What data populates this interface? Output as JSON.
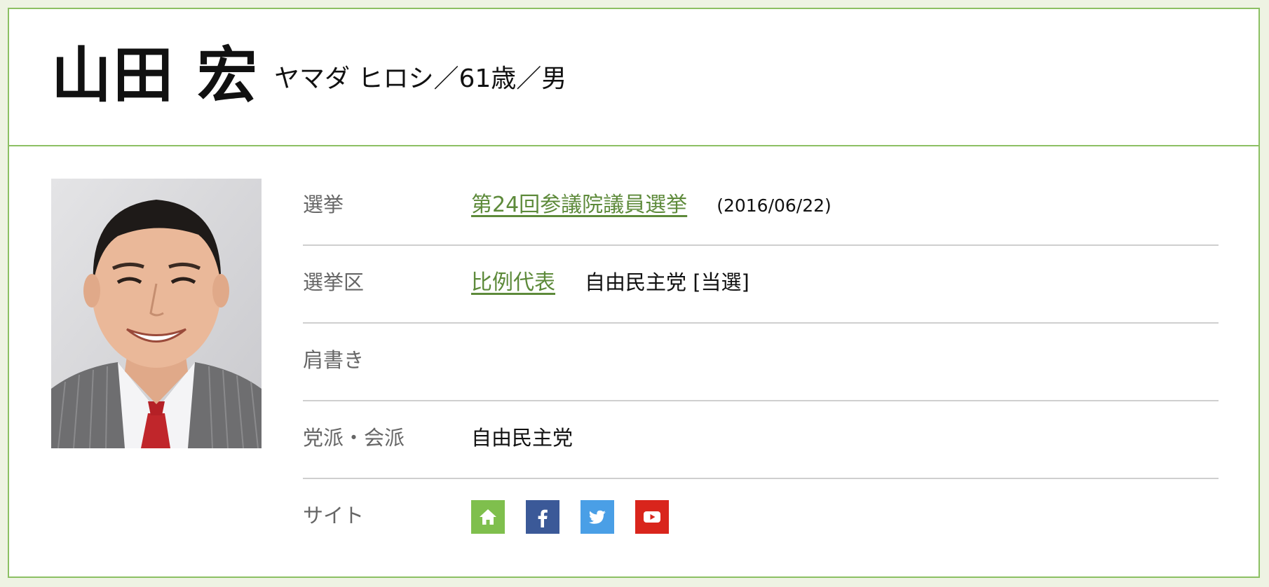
{
  "profile": {
    "name": "山田 宏",
    "kana_age_gender": "ヤマダ ヒロシ／61歳／男"
  },
  "rows": {
    "election": {
      "label": "選挙",
      "link": "第24回参議院議員選挙",
      "date": "(2016/06/22)"
    },
    "district": {
      "label": "選挙区",
      "link": "比例代表",
      "party_result": "自由民主党 [当選]"
    },
    "title": {
      "label": "肩書き",
      "value": ""
    },
    "party": {
      "label": "党派・会派",
      "value": "自由民主党"
    },
    "site": {
      "label": "サイト",
      "icons": [
        "home-icon",
        "facebook-icon",
        "twitter-icon",
        "youtube-icon"
      ]
    }
  },
  "colors": {
    "accent_green": "#8cc063",
    "link_green": "#5d8a3a",
    "home": "#7fbf4d",
    "facebook": "#3b5998",
    "twitter": "#4a9fe6",
    "youtube": "#d9251c"
  }
}
